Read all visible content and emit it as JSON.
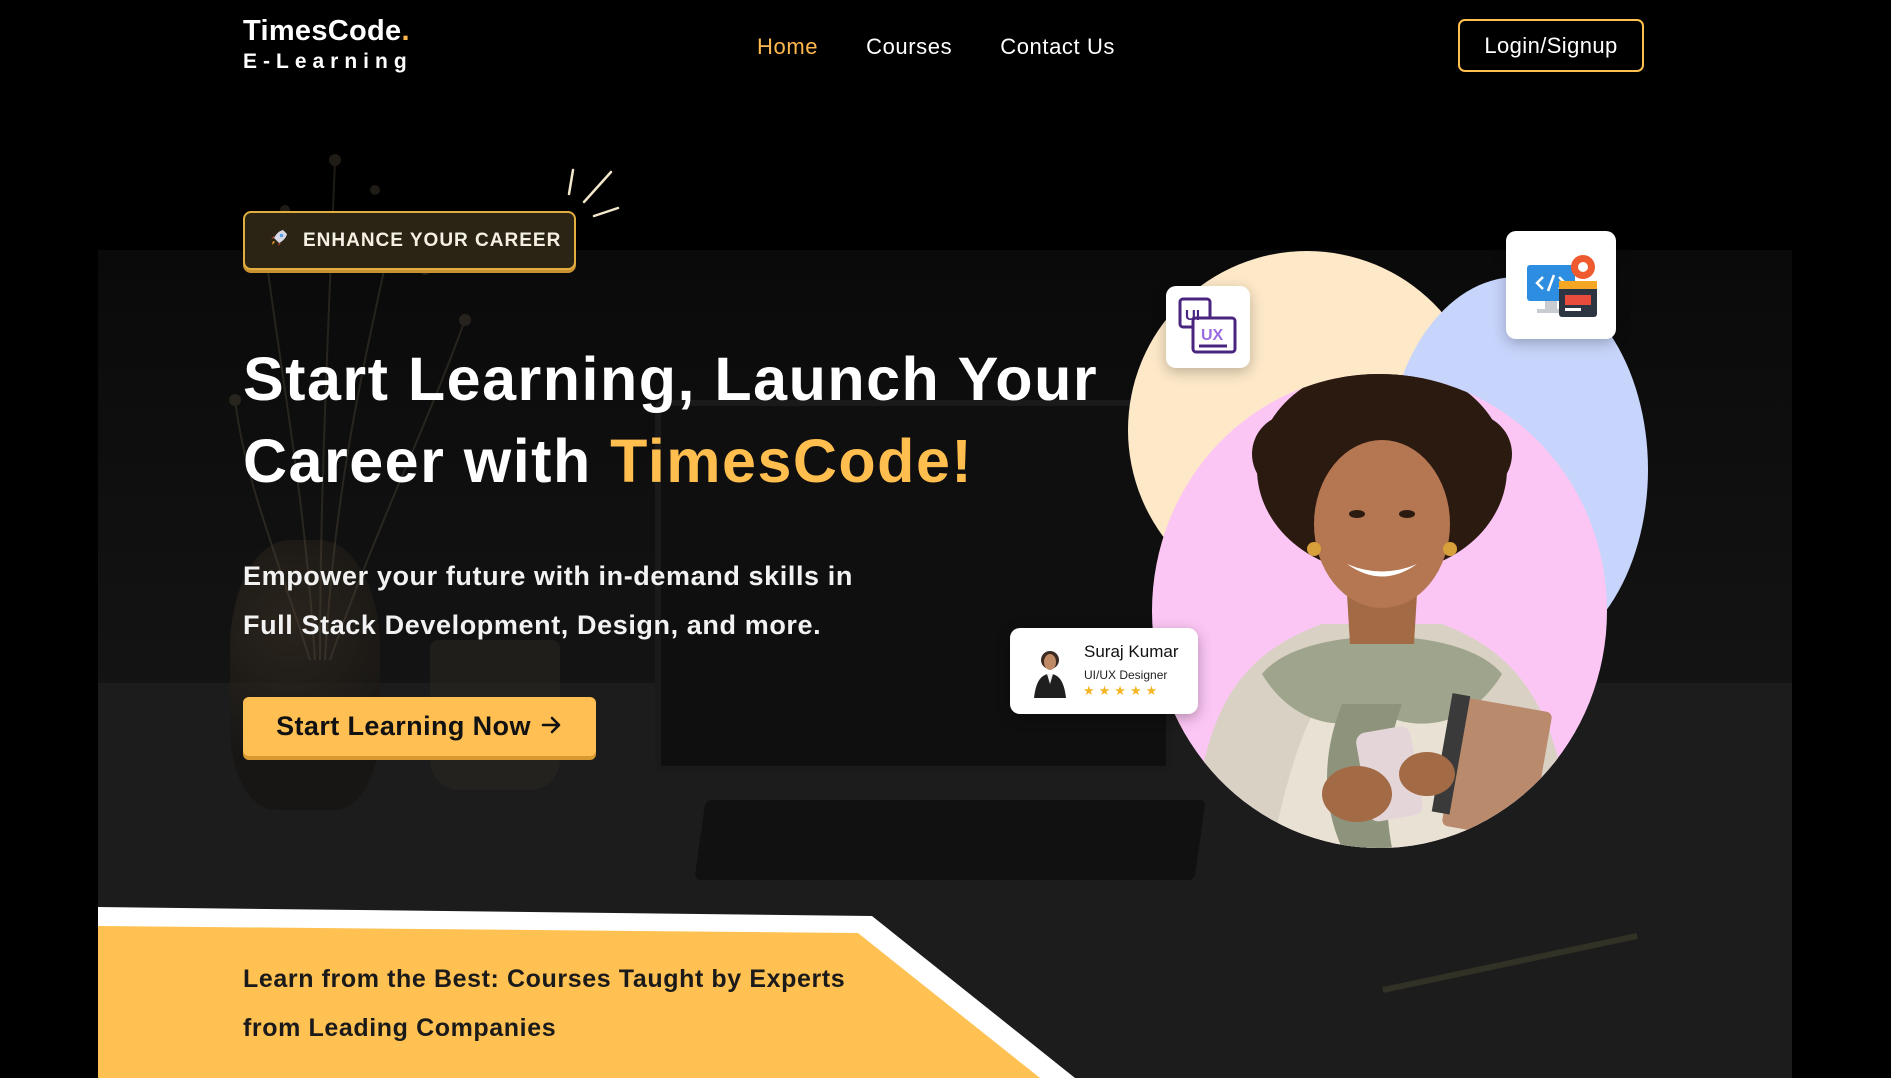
{
  "header": {
    "logo_title": "TimesCode",
    "logo_dot": ".",
    "logo_subtitle": "E-Learning",
    "nav": [
      {
        "label": "Home",
        "active": true
      },
      {
        "label": "Courses",
        "active": false
      },
      {
        "label": "Contact Us",
        "active": false
      }
    ],
    "login_label": "Login/Signup"
  },
  "hero": {
    "badge_icon": "rocket-icon",
    "badge_text": "ENHANCE YOUR CAREER",
    "title_line1": "Start Learning, Launch Your",
    "title_line2_prefix": "Career with ",
    "title_accent": "TimesCode!",
    "desc_line1": "Empower your future with in-demand skills in",
    "desc_line2": "Full Stack Development, Design, and more.",
    "cta_label": "Start Learning Now",
    "cta_icon": "arrow-right-icon"
  },
  "review_card": {
    "name": "Suraj Kumar",
    "role": "UI/UX Designer",
    "rating": 5,
    "stars": "★★★★★"
  },
  "icons": {
    "uiux_text_top": "UI",
    "uiux_text_bottom": "UX"
  },
  "banner": {
    "line1": "Learn from the Best: Courses Taught by Experts",
    "line2": "from Leading Companies"
  },
  "colors": {
    "accent": "#FFBE4D",
    "background": "#000000",
    "banner": "#FFC152",
    "circle_yellow": "#FDE9C8",
    "circle_blue": "#C7D4FB",
    "circle_pink": "#FCC6F4"
  }
}
